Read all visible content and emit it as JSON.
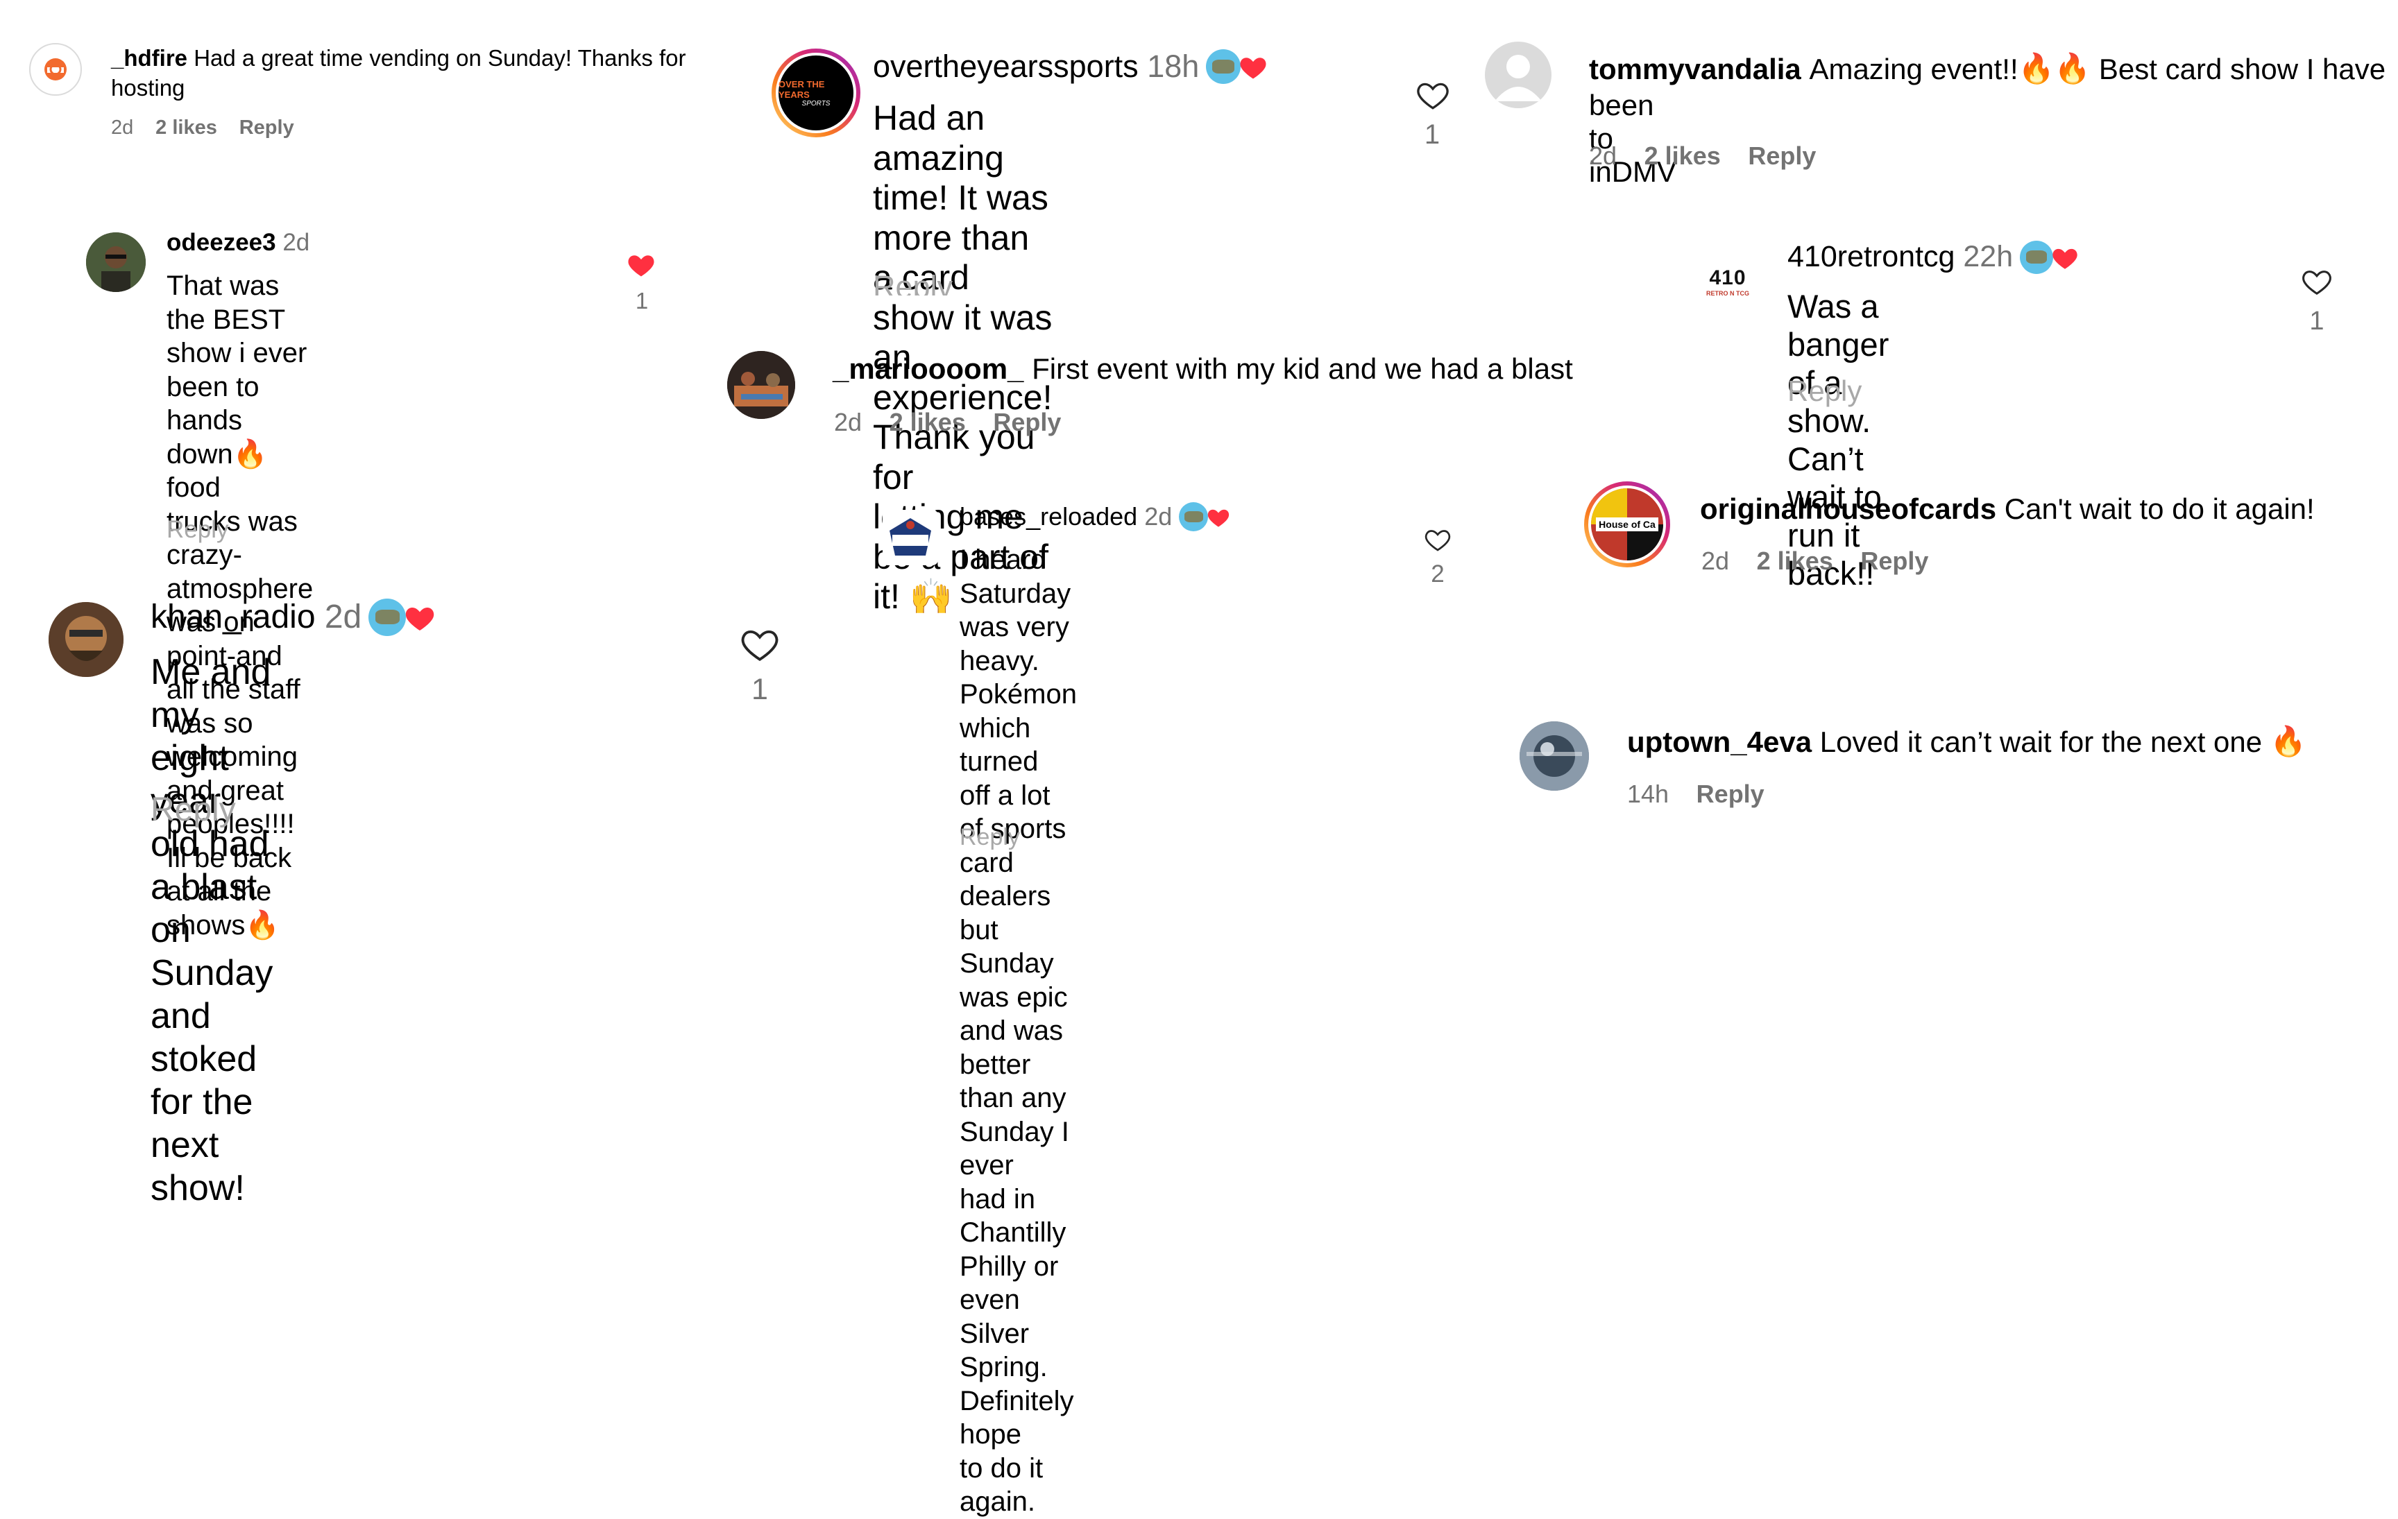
{
  "colors": {
    "text": "#000000",
    "meta": "#737373",
    "reply_faded": "#a8a8a8",
    "like_red": "#ff3040",
    "sticker_blue": "#5ec1e8"
  },
  "icons": {
    "like": "heart-outline-icon",
    "liked": "heart-filled-icon"
  },
  "comments": {
    "hdfire": {
      "user": "_hdfire",
      "text_line1": "Had a great time vending on Sunday! Thanks for",
      "text_line2": "hosting",
      "time": "2d",
      "likes": "2 likes",
      "reply": "Reply"
    },
    "odeezee": {
      "user": "odeezee3",
      "time": "2d",
      "lines": [
        "That was the BEST show i ever",
        "been to hands down",
        "food",
        "trucks was crazy-atmosphere",
        "was on point-and all the staff",
        "was so welcoming and great",
        "peoples!!!! Ill be back at all the",
        "shows"
      ],
      "like_count": "1",
      "reply": "Reply"
    },
    "khan": {
      "user": "khan_radio",
      "time": "2d",
      "lines": [
        "Me and my eight year old had",
        "a blast on Sunday and stoked",
        "for the next show!"
      ],
      "like_count": "1",
      "reply": "Reply"
    },
    "overtheyears": {
      "user": "overtheyearssports",
      "time": "18h",
      "lines": [
        "Had an amazing time! It was",
        "more than a card show it was",
        "an experience! Thank you for",
        "letting me be a part of it!"
      ],
      "like_count": "1",
      "reply": "Reply",
      "avatar_text_1": "OVER THE YEARS",
      "avatar_text_2": "SPORTS"
    },
    "marioooom": {
      "user": "_marioooom_",
      "text": "First event with my kid and we had a blast",
      "time": "2d",
      "likes": "2 likes",
      "reply": "Reply"
    },
    "bases": {
      "user": "bases_reloaded",
      "time": "2d",
      "lines": [
        "I heard Saturday was very",
        "heavy. Pokémon which turned",
        "off a lot of sports card dealers",
        "but Sunday was epic and was",
        "better than any Sunday I ever",
        "had in Chantilly Philly or even",
        "Silver Spring. Definitely hope",
        "to do it again."
      ],
      "like_count": "2",
      "reply": "Reply",
      "avatar_text": "BASES"
    },
    "tommy": {
      "user": "tommyvandalia",
      "text_a": "Amazing event!!",
      "text_b": "Best card show I have",
      "text_line2": "been to inDMV",
      "time": "2d",
      "likes": "2 likes",
      "reply": "Reply"
    },
    "retro410": {
      "user": "410retrontcg",
      "time": "22h",
      "lines": [
        "Was a banger of a show. Can’t",
        "wait to run it back!!"
      ],
      "like_count": "1",
      "reply": "Reply",
      "avatar_text_1": "410",
      "avatar_text_2": "RETRO N TCG"
    },
    "originalhouse": {
      "user": "originalhouseofcards",
      "text": "Can't wait to do it again!",
      "time": "2d",
      "likes": "2 likes",
      "reply": "Reply",
      "avatar_text": "House of Ca"
    },
    "uptown": {
      "user": "uptown_4eva",
      "text": "Loved it can’t wait for the next one",
      "time": "14h",
      "reply": "Reply"
    }
  }
}
